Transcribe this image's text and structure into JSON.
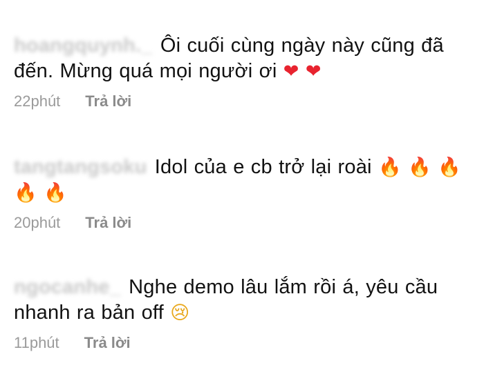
{
  "comments": [
    {
      "username": "hoangquynh._",
      "text": "Ôi cuối cùng ngày này cũng đã đến. Mừng quá mọi người ơi",
      "emojis": [
        "❤",
        "❤"
      ],
      "time": "22phút",
      "reply_label": "Trả lời"
    },
    {
      "username": "tangtangsoku",
      "text": "Idol của e cb trở lại roài",
      "emojis": [
        "🔥",
        "🔥",
        "🔥",
        "🔥",
        "🔥"
      ],
      "time": "20phút",
      "reply_label": "Trả lời"
    },
    {
      "username": "ngocanhe_",
      "text": "Nghe demo lâu lắm rồi á, yêu cầu nhanh ra bản off",
      "emojis": [
        "😢"
      ],
      "time": "11phút",
      "reply_label": "Trả lời"
    }
  ],
  "colors": {
    "text": "#111111",
    "meta": "#8e8e8e",
    "heart": "#e8232f",
    "fire": "#f26a0d"
  },
  "icons": [
    "heart-emoji-icon",
    "fire-emoji-icon",
    "crying-face-emoji-icon"
  ]
}
